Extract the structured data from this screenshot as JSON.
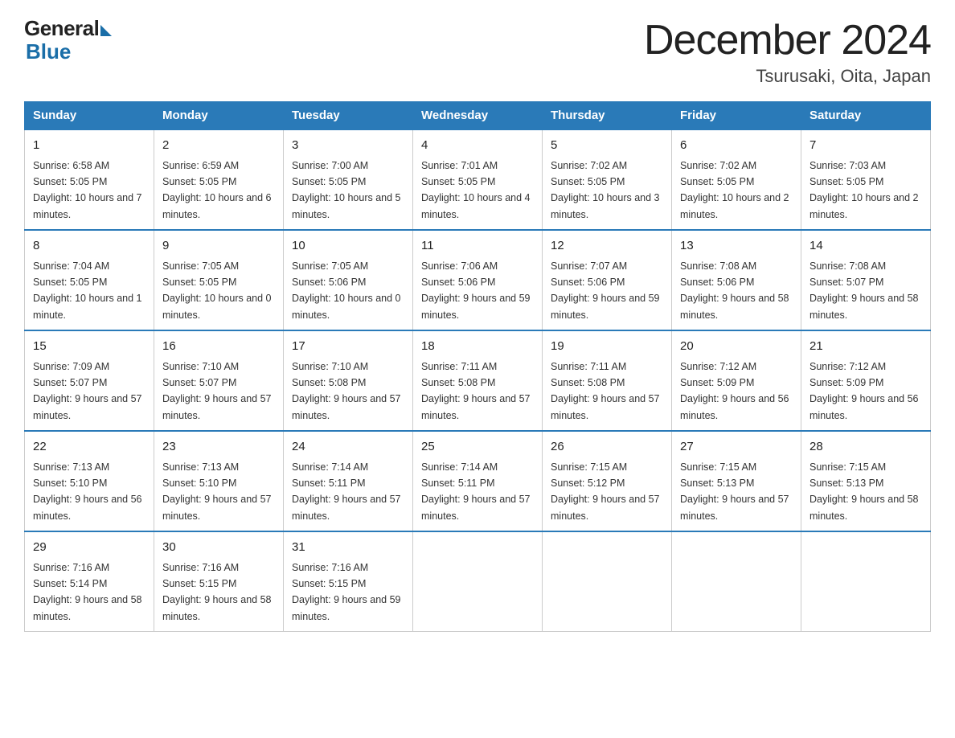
{
  "logo": {
    "general": "General",
    "blue": "Blue"
  },
  "title": "December 2024",
  "subtitle": "Tsurusaki, Oita, Japan",
  "days_of_week": [
    "Sunday",
    "Monday",
    "Tuesday",
    "Wednesday",
    "Thursday",
    "Friday",
    "Saturday"
  ],
  "weeks": [
    [
      {
        "day": "1",
        "sunrise": "6:58 AM",
        "sunset": "5:05 PM",
        "daylight": "10 hours and 7 minutes."
      },
      {
        "day": "2",
        "sunrise": "6:59 AM",
        "sunset": "5:05 PM",
        "daylight": "10 hours and 6 minutes."
      },
      {
        "day": "3",
        "sunrise": "7:00 AM",
        "sunset": "5:05 PM",
        "daylight": "10 hours and 5 minutes."
      },
      {
        "day": "4",
        "sunrise": "7:01 AM",
        "sunset": "5:05 PM",
        "daylight": "10 hours and 4 minutes."
      },
      {
        "day": "5",
        "sunrise": "7:02 AM",
        "sunset": "5:05 PM",
        "daylight": "10 hours and 3 minutes."
      },
      {
        "day": "6",
        "sunrise": "7:02 AM",
        "sunset": "5:05 PM",
        "daylight": "10 hours and 2 minutes."
      },
      {
        "day": "7",
        "sunrise": "7:03 AM",
        "sunset": "5:05 PM",
        "daylight": "10 hours and 2 minutes."
      }
    ],
    [
      {
        "day": "8",
        "sunrise": "7:04 AM",
        "sunset": "5:05 PM",
        "daylight": "10 hours and 1 minute."
      },
      {
        "day": "9",
        "sunrise": "7:05 AM",
        "sunset": "5:05 PM",
        "daylight": "10 hours and 0 minutes."
      },
      {
        "day": "10",
        "sunrise": "7:05 AM",
        "sunset": "5:06 PM",
        "daylight": "10 hours and 0 minutes."
      },
      {
        "day": "11",
        "sunrise": "7:06 AM",
        "sunset": "5:06 PM",
        "daylight": "9 hours and 59 minutes."
      },
      {
        "day": "12",
        "sunrise": "7:07 AM",
        "sunset": "5:06 PM",
        "daylight": "9 hours and 59 minutes."
      },
      {
        "day": "13",
        "sunrise": "7:08 AM",
        "sunset": "5:06 PM",
        "daylight": "9 hours and 58 minutes."
      },
      {
        "day": "14",
        "sunrise": "7:08 AM",
        "sunset": "5:07 PM",
        "daylight": "9 hours and 58 minutes."
      }
    ],
    [
      {
        "day": "15",
        "sunrise": "7:09 AM",
        "sunset": "5:07 PM",
        "daylight": "9 hours and 57 minutes."
      },
      {
        "day": "16",
        "sunrise": "7:10 AM",
        "sunset": "5:07 PM",
        "daylight": "9 hours and 57 minutes."
      },
      {
        "day": "17",
        "sunrise": "7:10 AM",
        "sunset": "5:08 PM",
        "daylight": "9 hours and 57 minutes."
      },
      {
        "day": "18",
        "sunrise": "7:11 AM",
        "sunset": "5:08 PM",
        "daylight": "9 hours and 57 minutes."
      },
      {
        "day": "19",
        "sunrise": "7:11 AM",
        "sunset": "5:08 PM",
        "daylight": "9 hours and 57 minutes."
      },
      {
        "day": "20",
        "sunrise": "7:12 AM",
        "sunset": "5:09 PM",
        "daylight": "9 hours and 56 minutes."
      },
      {
        "day": "21",
        "sunrise": "7:12 AM",
        "sunset": "5:09 PM",
        "daylight": "9 hours and 56 minutes."
      }
    ],
    [
      {
        "day": "22",
        "sunrise": "7:13 AM",
        "sunset": "5:10 PM",
        "daylight": "9 hours and 56 minutes."
      },
      {
        "day": "23",
        "sunrise": "7:13 AM",
        "sunset": "5:10 PM",
        "daylight": "9 hours and 57 minutes."
      },
      {
        "day": "24",
        "sunrise": "7:14 AM",
        "sunset": "5:11 PM",
        "daylight": "9 hours and 57 minutes."
      },
      {
        "day": "25",
        "sunrise": "7:14 AM",
        "sunset": "5:11 PM",
        "daylight": "9 hours and 57 minutes."
      },
      {
        "day": "26",
        "sunrise": "7:15 AM",
        "sunset": "5:12 PM",
        "daylight": "9 hours and 57 minutes."
      },
      {
        "day": "27",
        "sunrise": "7:15 AM",
        "sunset": "5:13 PM",
        "daylight": "9 hours and 57 minutes."
      },
      {
        "day": "28",
        "sunrise": "7:15 AM",
        "sunset": "5:13 PM",
        "daylight": "9 hours and 58 minutes."
      }
    ],
    [
      {
        "day": "29",
        "sunrise": "7:16 AM",
        "sunset": "5:14 PM",
        "daylight": "9 hours and 58 minutes."
      },
      {
        "day": "30",
        "sunrise": "7:16 AM",
        "sunset": "5:15 PM",
        "daylight": "9 hours and 58 minutes."
      },
      {
        "day": "31",
        "sunrise": "7:16 AM",
        "sunset": "5:15 PM",
        "daylight": "9 hours and 59 minutes."
      },
      {
        "day": "",
        "sunrise": "",
        "sunset": "",
        "daylight": ""
      },
      {
        "day": "",
        "sunrise": "",
        "sunset": "",
        "daylight": ""
      },
      {
        "day": "",
        "sunrise": "",
        "sunset": "",
        "daylight": ""
      },
      {
        "day": "",
        "sunrise": "",
        "sunset": "",
        "daylight": ""
      }
    ]
  ]
}
